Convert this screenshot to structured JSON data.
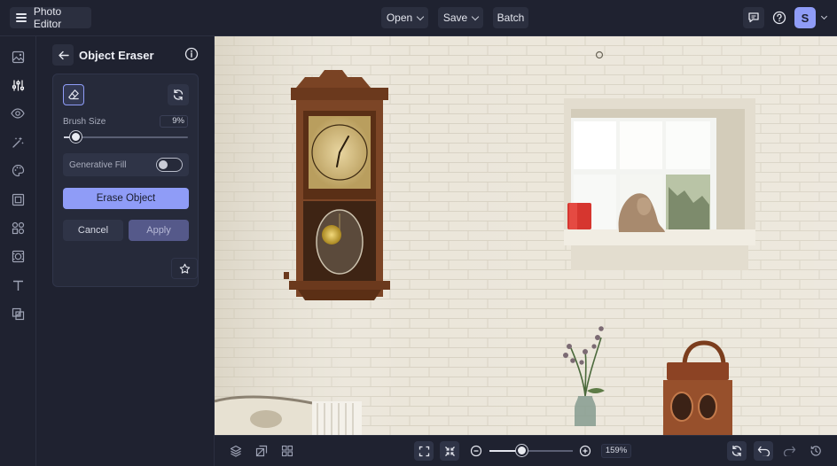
{
  "header": {
    "app_title": "Photo Editor",
    "open_label": "Open",
    "save_label": "Save",
    "batch_label": "Batch",
    "avatar_initial": "S"
  },
  "rail": {
    "items": [
      "image-icon",
      "adjust-sliders-icon",
      "eye-icon",
      "magic-wand-icon",
      "palette-icon",
      "frame-icon",
      "shapes-icon",
      "overlay-icon",
      "text-icon",
      "texture-icon"
    ],
    "active_index": 1
  },
  "panel": {
    "title": "Object Eraser",
    "brush_size_label": "Brush Size",
    "brush_size_value": "9%",
    "brush_size_fraction": 0.09,
    "generative_fill_label": "Generative Fill",
    "generative_fill_on": false,
    "erase_label": "Erase Object",
    "cancel_label": "Cancel",
    "apply_label": "Apply"
  },
  "zoom": {
    "value_label": "159%",
    "slider_fraction": 0.38
  },
  "colors": {
    "background": "#1f2230",
    "surface": "#262a3a",
    "button": "#2b2f3f",
    "accent": "#8f9cf7",
    "apply_disabled": "#55598a"
  }
}
